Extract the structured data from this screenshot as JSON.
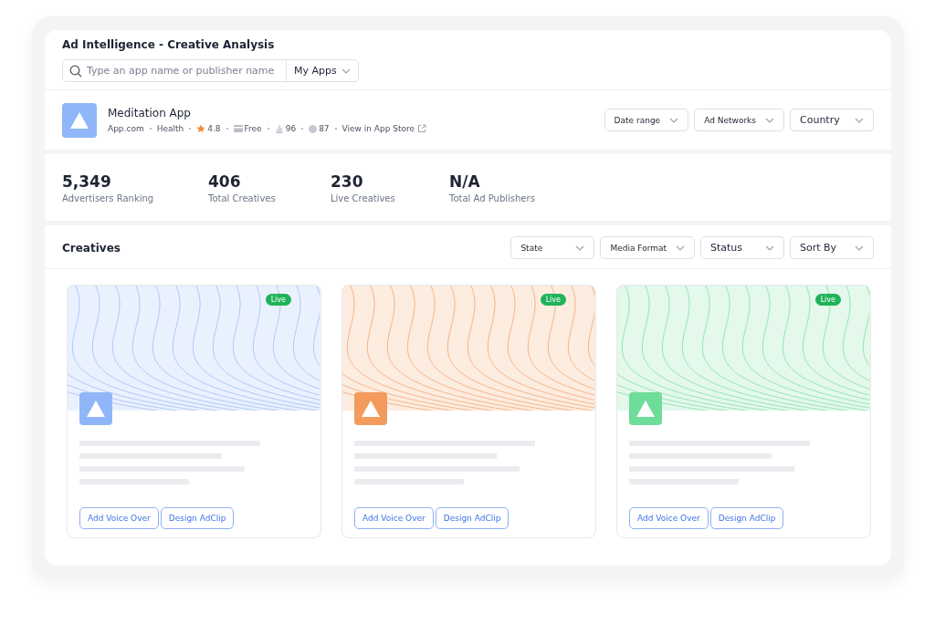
{
  "header": {
    "title": "Ad Intelligence - Creative Analysis",
    "search": {
      "placeholder": "Type an app name or publisher name"
    },
    "scope_dropdown": "My Apps"
  },
  "app": {
    "name": "Meditation App",
    "meta": [
      {
        "kind": "text",
        "text": "App.com"
      },
      {
        "kind": "text",
        "text": "Health"
      },
      {
        "kind": "rating",
        "text": "4.8"
      },
      {
        "kind": "price",
        "text": "Free"
      },
      {
        "kind": "rank",
        "text": "96"
      },
      {
        "kind": "score",
        "text": "87"
      },
      {
        "kind": "link",
        "text": "View in App Store"
      }
    ],
    "filters": [
      "Date range",
      "Ad Networks",
      "Country"
    ]
  },
  "stats": [
    {
      "value": "5,349",
      "label": "Advertisers Ranking"
    },
    {
      "value": "406",
      "label": "Total Creatives"
    },
    {
      "value": "230",
      "label": "Live Creatives"
    },
    {
      "value": "N/A",
      "label": "Total Ad Publishers"
    }
  ],
  "creatives": {
    "title": "Creatives",
    "filters": [
      "State",
      "Media Format",
      "Status",
      "Sort By"
    ],
    "cards": [
      {
        "color": "#8fb6f8",
        "badge": "Live",
        "actions": [
          "Add Voice Over",
          "Design AdClip"
        ]
      },
      {
        "color": "#f29b5c",
        "badge": "Live",
        "actions": [
          "Add Voice Over",
          "Design AdClip"
        ]
      },
      {
        "color": "#6fdc9a",
        "badge": "Live",
        "actions": [
          "Add Voice Over",
          "Design AdClip"
        ]
      }
    ]
  }
}
